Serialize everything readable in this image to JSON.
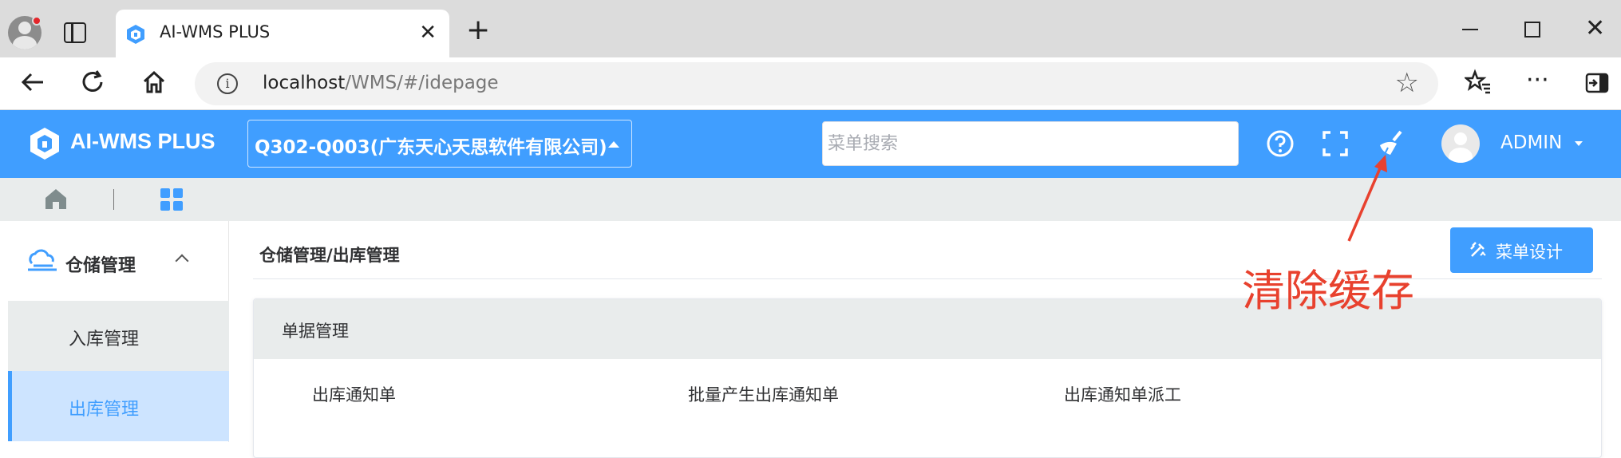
{
  "browser": {
    "tab_title": "AI-WMS PLUS",
    "url_host": "localhost",
    "url_path": "/WMS/#/idepage",
    "icons": [
      "profile-icon",
      "tab-actions-icon",
      "close-icon",
      "new-tab-icon",
      "minimize-icon",
      "maximize-icon",
      "window-close-icon",
      "back-icon",
      "refresh-icon",
      "home-icon",
      "info-icon",
      "favorite-star-icon",
      "favorites-icon",
      "more-icon",
      "sidebar-icon"
    ]
  },
  "header": {
    "app_title": "AI-WMS PLUS",
    "company": "Q302-Q003(广东天心天思软件有限公司)",
    "search_placeholder": "菜单搜索",
    "user": "ADMIN",
    "color": "#409eff"
  },
  "sidebar": {
    "group_label": "仓储管理",
    "items": [
      {
        "label": "入库管理",
        "active": false
      },
      {
        "label": "出库管理",
        "active": true
      }
    ]
  },
  "main": {
    "breadcrumb": "仓储管理/出库管理",
    "design_button": "菜单设计",
    "card_title": "单据管理",
    "links": [
      "出库通知单",
      "批量产生出库通知单",
      "出库通知单派工"
    ]
  },
  "annotation": {
    "text": "清除缓存",
    "color": "#e8412e"
  }
}
